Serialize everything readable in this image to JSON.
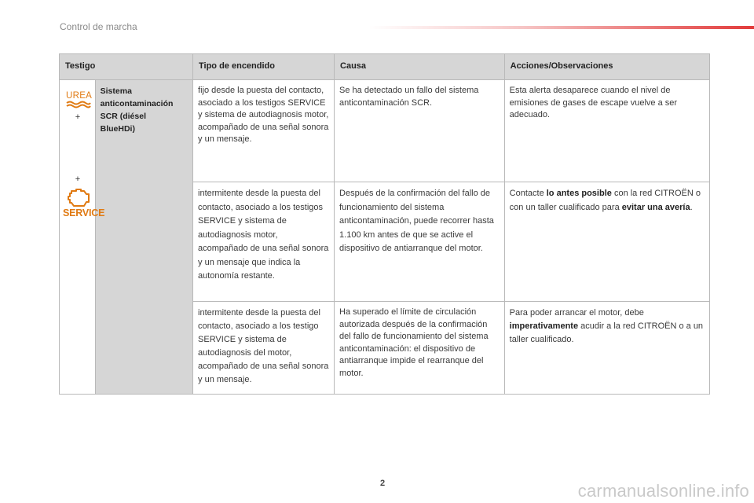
{
  "header": {
    "section_title": "Control de marcha"
  },
  "table": {
    "columns": [
      "Testigo",
      "Tipo de encendido",
      "Causa",
      "Acciones/Observaciones"
    ],
    "system_name": [
      "Sistema",
      "anticontaminación",
      "SCR (diésel",
      "BlueHDi)"
    ],
    "icons": {
      "urea_label": "UREA",
      "plus": "+",
      "service_label": "SERVICE"
    },
    "rows": [
      {
        "type": "fijo desde la puesta del contacto, asociado a los testigos SERVICE y sistema de autodiagnosis motor, acompañado de una señal sonora y un mensaje.",
        "cause": "Se ha detectado un fallo del sistema anticontaminación SCR.",
        "action_pre": "Esta alerta desaparece cuando el nivel de emisiones de gases de escape vuelve a ser adecuado.",
        "action_bold1": "",
        "action_mid": "",
        "action_bold2": "",
        "action_post": ""
      },
      {
        "type": "intermitente desde la puesta del contacto, asociado a los testigos SERVICE y sistema de autodiagnosis motor, acompañado de una señal sonora y un mensaje que indica la autonomía restante.",
        "cause": "Después de la confirmación del fallo de funcionamiento del sistema anticontaminación, puede recorrer hasta 1.100 km antes de que se active el dispositivo de antiarranque del motor.",
        "action_pre": "Contacte ",
        "action_bold1": "lo antes posible",
        "action_mid": " con la red CITROËN o con un taller cualificado para ",
        "action_bold2": "evitar una avería",
        "action_post": "."
      },
      {
        "type": "intermitente desde la puesta del contacto, asociado a los testigo SERVICE y sistema de autodiagnosis del motor, acompañado de una señal sonora y un mensaje.",
        "cause": "Ha superado el límite de circulación autorizada después de la confirmación del fallo de funcionamiento del sistema anticontaminación: el dispositivo de antiarranque impide el rearranque del motor.",
        "action_pre": "Para poder arrancar el motor, debe ",
        "action_bold1": "imperativamente",
        "action_mid": " acudir a la red CITROËN o a un taller cualificado.",
        "action_bold2": "",
        "action_post": ""
      }
    ]
  },
  "footer": {
    "page_number": "2",
    "watermark": "carmanualsonline.info"
  },
  "colors": {
    "header_bg": "#d6d6d6",
    "icon_orange": "#e07a12",
    "accent_red": "#e23b3b"
  }
}
